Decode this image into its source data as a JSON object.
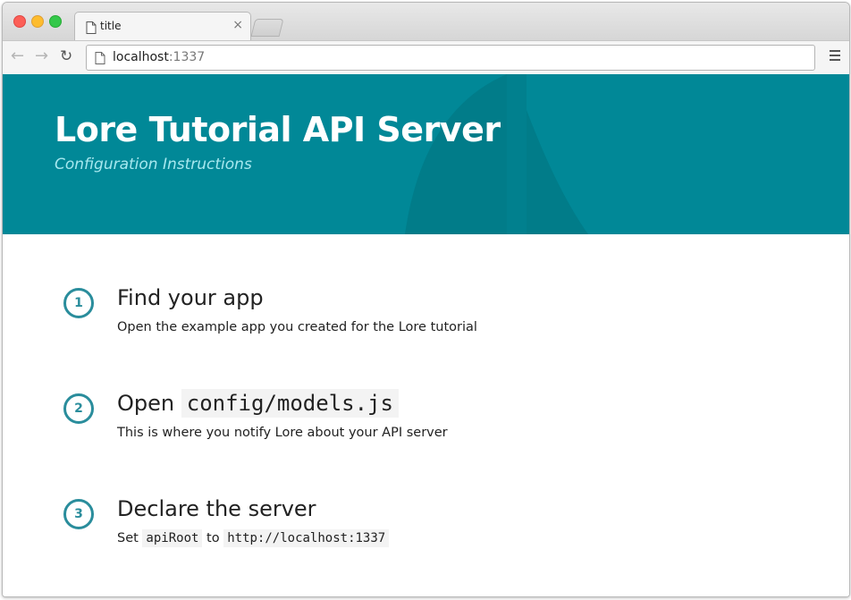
{
  "browser": {
    "tab_title": "title",
    "tab_close": "×",
    "url_host": "localhost",
    "url_port": ":1337",
    "icons": [
      "back-arrow-icon",
      "forward-arrow-icon",
      "reload-icon",
      "page-icon",
      "hamburger-menu-icon"
    ]
  },
  "hero": {
    "title": "Lore Tutorial API Server",
    "subtitle": "Configuration Instructions",
    "background_color": "#018897"
  },
  "steps": [
    {
      "number": "1",
      "title": "Find your app",
      "description": "Open the example app you created for the Lore tutorial"
    },
    {
      "number": "2",
      "title_prefix": "Open",
      "title_code": "config/models.js",
      "description": "This is where you notify Lore about your API server"
    },
    {
      "number": "3",
      "title": "Declare the server",
      "desc_part1": "Set",
      "desc_code1": "apiRoot",
      "desc_part2": "to",
      "desc_code2": "http://localhost:1337"
    }
  ],
  "colors": {
    "accent": "#2a8d9c",
    "subtitle": "#a7e8ef"
  }
}
